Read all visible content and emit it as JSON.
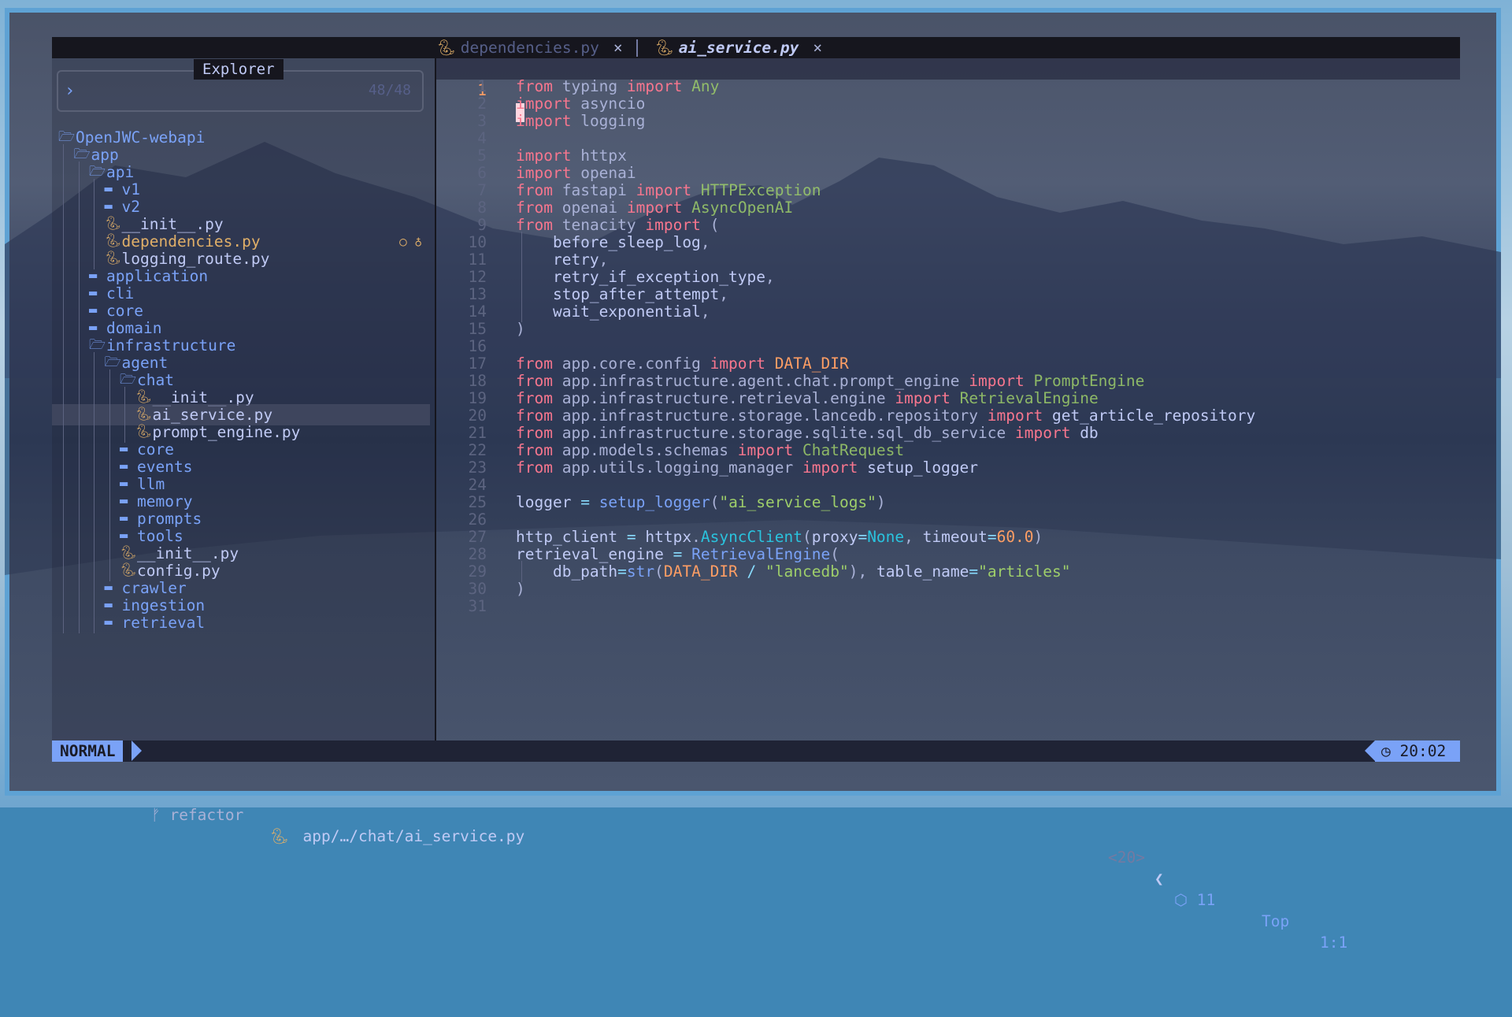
{
  "tabs": [
    {
      "icon": "python-icon",
      "label": "dependencies.py",
      "close": "×",
      "active": false
    },
    {
      "icon": "python-icon",
      "label": "ai_service.py",
      "close": "×",
      "active": true
    }
  ],
  "explorer": {
    "title": "Explorer",
    "prompt_symbol": "›",
    "count": "48/48",
    "items": [
      {
        "label": "OpenJWC-webapi",
        "type": "dir-open",
        "depth": 0
      },
      {
        "label": "app",
        "type": "dir-open",
        "depth": 1
      },
      {
        "label": "api",
        "type": "dir-open",
        "depth": 2
      },
      {
        "label": "v1",
        "type": "dir",
        "depth": 3
      },
      {
        "label": "v2",
        "type": "dir",
        "depth": 3
      },
      {
        "label": "__init__.py",
        "type": "py",
        "depth": 3
      },
      {
        "label": "dependencies.py",
        "type": "py-mod",
        "depth": 3
      },
      {
        "label": "logging_route.py",
        "type": "py",
        "depth": 3
      },
      {
        "label": "application",
        "type": "dir",
        "depth": 2
      },
      {
        "label": "cli",
        "type": "dir",
        "depth": 2
      },
      {
        "label": "core",
        "type": "dir",
        "depth": 2
      },
      {
        "label": "domain",
        "type": "dir",
        "depth": 2
      },
      {
        "label": "infrastructure",
        "type": "dir-open",
        "depth": 2
      },
      {
        "label": "agent",
        "type": "dir-open",
        "depth": 3
      },
      {
        "label": "chat",
        "type": "dir-open",
        "depth": 4
      },
      {
        "label": "__init__.py",
        "type": "py",
        "depth": 5
      },
      {
        "label": "ai_service.py",
        "type": "py-sel",
        "depth": 5
      },
      {
        "label": "prompt_engine.py",
        "type": "py",
        "depth": 5
      },
      {
        "label": "core",
        "type": "dir",
        "depth": 4
      },
      {
        "label": "events",
        "type": "dir",
        "depth": 4
      },
      {
        "label": "llm",
        "type": "dir",
        "depth": 4
      },
      {
        "label": "memory",
        "type": "dir",
        "depth": 4
      },
      {
        "label": "prompts",
        "type": "dir",
        "depth": 4
      },
      {
        "label": "tools",
        "type": "dir",
        "depth": 4
      },
      {
        "label": "__init__.py",
        "type": "py",
        "depth": 4
      },
      {
        "label": "config.py",
        "type": "py",
        "depth": 4
      },
      {
        "label": "crawler",
        "type": "dir",
        "depth": 3
      },
      {
        "label": "ingestion",
        "type": "dir",
        "depth": 3
      },
      {
        "label": "retrieval",
        "type": "dir",
        "depth": 3
      }
    ]
  },
  "editor": {
    "current_line_number": "1",
    "lines": [
      {
        "n": "1",
        "tokens": [
          [
            "kw",
            "from"
          ],
          [
            "id",
            " "
          ],
          [
            "mod",
            "typing"
          ],
          [
            "id",
            " "
          ],
          [
            "kw",
            "import"
          ],
          [
            "id",
            " "
          ],
          [
            "cls",
            "Any"
          ]
        ]
      },
      {
        "n": "2",
        "tokens": [
          [
            "kw",
            "import"
          ],
          [
            "id",
            " "
          ],
          [
            "mod",
            "asyncio"
          ]
        ]
      },
      {
        "n": "3",
        "tokens": [
          [
            "kw",
            "import"
          ],
          [
            "id",
            " "
          ],
          [
            "mod",
            "logging"
          ]
        ]
      },
      {
        "n": "4",
        "tokens": []
      },
      {
        "n": "5",
        "tokens": [
          [
            "kw",
            "import"
          ],
          [
            "id",
            " "
          ],
          [
            "mod",
            "httpx"
          ]
        ]
      },
      {
        "n": "6",
        "tokens": [
          [
            "kw",
            "import"
          ],
          [
            "id",
            " "
          ],
          [
            "mod",
            "openai"
          ]
        ]
      },
      {
        "n": "7",
        "tokens": [
          [
            "kw",
            "from"
          ],
          [
            "id",
            " "
          ],
          [
            "mod",
            "fastapi"
          ],
          [
            "id",
            " "
          ],
          [
            "kw",
            "import"
          ],
          [
            "id",
            " "
          ],
          [
            "cls",
            "HTTPException"
          ]
        ]
      },
      {
        "n": "8",
        "tokens": [
          [
            "kw",
            "from"
          ],
          [
            "id",
            " "
          ],
          [
            "mod",
            "openai"
          ],
          [
            "id",
            " "
          ],
          [
            "kw",
            "import"
          ],
          [
            "id",
            " "
          ],
          [
            "cls",
            "AsyncOpenAI"
          ]
        ]
      },
      {
        "n": "9",
        "tokens": [
          [
            "kw",
            "from"
          ],
          [
            "id",
            " "
          ],
          [
            "mod",
            "tenacity"
          ],
          [
            "id",
            " "
          ],
          [
            "kw",
            "import"
          ],
          [
            "id",
            " "
          ],
          [
            "punc",
            "("
          ]
        ]
      },
      {
        "n": "10",
        "indent": true,
        "tokens": [
          [
            "id",
            "    before_sleep_log"
          ],
          [
            "punc",
            ","
          ]
        ]
      },
      {
        "n": "11",
        "indent": true,
        "tokens": [
          [
            "id",
            "    retry"
          ],
          [
            "punc",
            ","
          ]
        ]
      },
      {
        "n": "12",
        "indent": true,
        "tokens": [
          [
            "id",
            "    retry_if_exception_type"
          ],
          [
            "punc",
            ","
          ]
        ]
      },
      {
        "n": "13",
        "indent": true,
        "tokens": [
          [
            "id",
            "    stop_after_attempt"
          ],
          [
            "punc",
            ","
          ]
        ]
      },
      {
        "n": "14",
        "indent": true,
        "tokens": [
          [
            "id",
            "    wait_exponential"
          ],
          [
            "punc",
            ","
          ]
        ]
      },
      {
        "n": "15",
        "tokens": [
          [
            "punc",
            ")"
          ]
        ]
      },
      {
        "n": "16",
        "tokens": []
      },
      {
        "n": "17",
        "tokens": [
          [
            "kw",
            "from"
          ],
          [
            "id",
            " "
          ],
          [
            "mod",
            "app.core.config"
          ],
          [
            "id",
            " "
          ],
          [
            "kw",
            "import"
          ],
          [
            "id",
            " "
          ],
          [
            "const",
            "DATA_DIR"
          ]
        ]
      },
      {
        "n": "18",
        "tokens": [
          [
            "kw",
            "from"
          ],
          [
            "id",
            " "
          ],
          [
            "mod",
            "app.infrastructure.agent.chat.prompt_engine"
          ],
          [
            "id",
            " "
          ],
          [
            "kw",
            "import"
          ],
          [
            "id",
            " "
          ],
          [
            "cls",
            "PromptEngine"
          ]
        ]
      },
      {
        "n": "19",
        "tokens": [
          [
            "kw",
            "from"
          ],
          [
            "id",
            " "
          ],
          [
            "mod",
            "app.infrastructure.retrieval.engine"
          ],
          [
            "id",
            " "
          ],
          [
            "kw",
            "import"
          ],
          [
            "id",
            " "
          ],
          [
            "cls",
            "RetrievalEngine"
          ]
        ]
      },
      {
        "n": "20",
        "tokens": [
          [
            "kw",
            "from"
          ],
          [
            "id",
            " "
          ],
          [
            "mod",
            "app.infrastructure.storage.lancedb.repository"
          ],
          [
            "id",
            " "
          ],
          [
            "kw",
            "import"
          ],
          [
            "id",
            " get_article_repository"
          ]
        ]
      },
      {
        "n": "21",
        "tokens": [
          [
            "kw",
            "from"
          ],
          [
            "id",
            " "
          ],
          [
            "mod",
            "app.infrastructure.storage.sqlite.sql_db_service"
          ],
          [
            "id",
            " "
          ],
          [
            "kw",
            "import"
          ],
          [
            "id",
            " db"
          ]
        ]
      },
      {
        "n": "22",
        "tokens": [
          [
            "kw",
            "from"
          ],
          [
            "id",
            " "
          ],
          [
            "mod",
            "app.models.schemas"
          ],
          [
            "id",
            " "
          ],
          [
            "kw",
            "import"
          ],
          [
            "id",
            " "
          ],
          [
            "cls",
            "ChatRequest"
          ]
        ]
      },
      {
        "n": "23",
        "tokens": [
          [
            "kw",
            "from"
          ],
          [
            "id",
            " "
          ],
          [
            "mod",
            "app.utils.logging_manager"
          ],
          [
            "id",
            " "
          ],
          [
            "kw",
            "import"
          ],
          [
            "id",
            " setup_logger"
          ]
        ]
      },
      {
        "n": "24",
        "tokens": []
      },
      {
        "n": "25",
        "tokens": [
          [
            "id",
            "logger "
          ],
          [
            "op",
            "="
          ],
          [
            "id",
            " "
          ],
          [
            "fn",
            "setup_logger"
          ],
          [
            "punc",
            "("
          ],
          [
            "str",
            "\"ai_service_logs\""
          ],
          [
            "punc",
            ")"
          ]
        ]
      },
      {
        "n": "26",
        "tokens": []
      },
      {
        "n": "27",
        "tokens": [
          [
            "id",
            "http_client "
          ],
          [
            "op",
            "="
          ],
          [
            "id",
            " httpx"
          ],
          [
            "punc",
            "."
          ],
          [
            "clsY",
            "AsyncClient"
          ],
          [
            "punc",
            "("
          ],
          [
            "id",
            "proxy"
          ],
          [
            "op",
            "="
          ],
          [
            "nonek",
            "None"
          ],
          [
            "punc",
            ", "
          ],
          [
            "id",
            "timeout"
          ],
          [
            "op",
            "="
          ],
          [
            "num",
            "60.0"
          ],
          [
            "punc",
            ")"
          ]
        ]
      },
      {
        "n": "28",
        "tokens": [
          [
            "id",
            "retrieval_engine "
          ],
          [
            "op",
            "="
          ],
          [
            "id",
            " "
          ],
          [
            "fn",
            "RetrievalEngine"
          ],
          [
            "punc",
            "("
          ]
        ]
      },
      {
        "n": "29",
        "indent": true,
        "tokens": [
          [
            "id",
            "    db_path"
          ],
          [
            "op",
            "="
          ],
          [
            "fn",
            "str"
          ],
          [
            "punc",
            "("
          ],
          [
            "const",
            "DATA_DIR"
          ],
          [
            "id",
            " "
          ],
          [
            "op",
            "/"
          ],
          [
            "id",
            " "
          ],
          [
            "str",
            "\"lancedb\""
          ],
          [
            "punc",
            "), "
          ],
          [
            "id",
            "table_name"
          ],
          [
            "op",
            "="
          ],
          [
            "str",
            "\"articles\""
          ]
        ]
      },
      {
        "n": "30",
        "tokens": [
          [
            "punc",
            ")"
          ]
        ]
      },
      {
        "n": "31",
        "tokens": []
      }
    ]
  },
  "status": {
    "mode": "NORMAL",
    "branch": "refactor",
    "file_path": "app/…/chat/ai_service.py",
    "lines": "<20>",
    "diagnostics": "11",
    "position": "Top",
    "cursor": "1:1",
    "time": "20:02"
  },
  "colors": {
    "accent": "#7aa2f7",
    "keyword": "#f7768e",
    "string": "#9ece6a",
    "constant": "#ff9e64",
    "modified": "#e0af68"
  }
}
